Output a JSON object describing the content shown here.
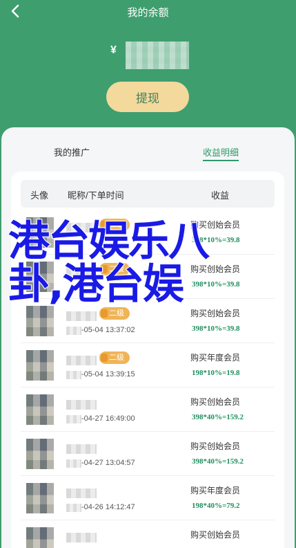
{
  "header": {
    "title": "我的余额",
    "balance_currency": "¥"
  },
  "withdraw_label": "提现",
  "tabs": [
    {
      "label": "我的推广",
      "active": false
    },
    {
      "label": "收益明细",
      "active": true
    }
  ],
  "table": {
    "columns": [
      "头像",
      "昵称/下单时间",
      "收益"
    ],
    "rows": [
      {
        "level": "二级",
        "time": "",
        "desc": "购买创始会员",
        "calc": "398*10%=39.8"
      },
      {
        "level": "二级",
        "time": "",
        "desc": "购买创始会员",
        "calc": "398*10%=39.8"
      },
      {
        "level": "二级",
        "time": "-05-04 13:37:02",
        "desc": "购买创始会员",
        "calc": "398*10%=39.8"
      },
      {
        "level": "二级",
        "time": "-05-04 13:39:15",
        "desc": "购买年度会员",
        "calc": "198*10%=19.8"
      },
      {
        "level": "",
        "time": "-04-27 16:49:00",
        "desc": "购买创始会员",
        "calc": "398*40%=159.2"
      },
      {
        "level": "",
        "time": "-04-27 13:04:57",
        "desc": "购买创始会员",
        "calc": "398*40%=159.2"
      },
      {
        "level": "",
        "time": "-04-26 14:12:47",
        "desc": "购买年度会员",
        "calc": "198*40%=79.2"
      },
      {
        "level": "",
        "time": "",
        "desc": "购买创始会员",
        "calc": ""
      }
    ]
  },
  "overlay_text": {
    "line1": "港台娱乐八",
    "line2": "卦,港台娱"
  },
  "colors": {
    "brand_green": "#3e9e6e",
    "button_gold": "#f3d99c",
    "badge_orange": "#f0b457",
    "overlay_blue": "#1a1ae6"
  }
}
